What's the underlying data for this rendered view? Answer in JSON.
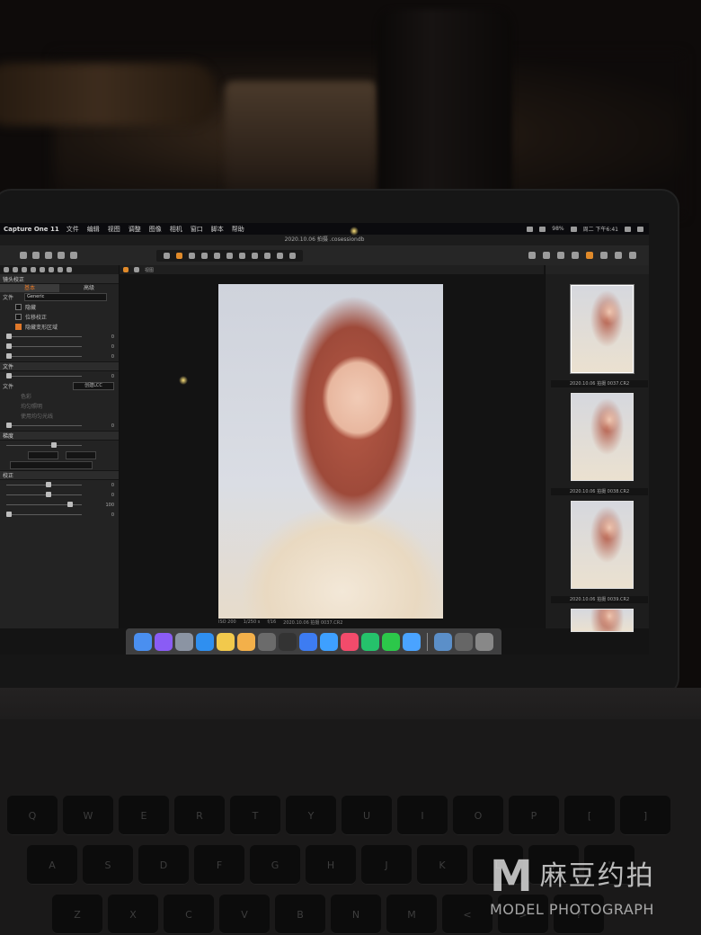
{
  "menubar": {
    "app_name": "Capture One 11",
    "items": [
      "文件",
      "编辑",
      "视图",
      "调整",
      "图像",
      "相机",
      "窗口",
      "脚本",
      "帮助"
    ],
    "battery": "98%",
    "datetime": "周二 下午6:41"
  },
  "titlebar": {
    "title": "2020.10.06 拍摄 .cosessiondb"
  },
  "left_panel": {
    "header": "镜头校正",
    "subtabs": [
      "基本",
      "高级"
    ],
    "profile_select": "Generic",
    "checks": [
      {
        "label": "隐藏",
        "checked": false
      },
      {
        "label": "位移校正",
        "checked": false
      },
      {
        "label": "隐藏变形区域",
        "checked": true
      }
    ],
    "lcc_section": "文件",
    "lcc_button": "创建LCC",
    "lcc_options": [
      "色彩",
      "均匀照明",
      "使用均匀光线"
    ],
    "section2": "梯度",
    "section3": "校正",
    "value_100": "100",
    "value_0": "0"
  },
  "viewer": {
    "bar_labels": [
      "视图"
    ],
    "caption": [
      "ISO 200",
      "1/250 s",
      "f/16",
      "2020.10.06 拍摄 0037.CR2"
    ]
  },
  "filmstrip": {
    "thumbs": [
      {
        "label": "2020.10.06 拍摄 0037.CR2",
        "selected": true
      },
      {
        "label": "2020.10.06 拍摄 0038.CR2",
        "selected": false
      },
      {
        "label": "2020.10.06 拍摄 0039.CR2",
        "selected": false
      }
    ]
  },
  "dock": {
    "icons": [
      "finder-icon",
      "siri-icon",
      "launchpad-icon",
      "safari-icon",
      "chrome-icon",
      "photos-icon",
      "capture-one-icon",
      "app-icon",
      "baidu-netdisk-icon",
      "wps-icon",
      "photo-app-icon",
      "media-player-icon",
      "wechat-icon",
      "info-icon",
      "preview-icon",
      "downloads-icon",
      "trash-icon"
    ],
    "colors": [
      "#4a8ff0",
      "#8a5cf5",
      "#8b94a3",
      "#2f8ff0",
      "#f2c94c",
      "#f3b04a",
      "#6b6b6b",
      "#333333",
      "#3d7cf2",
      "#3ea0ff",
      "#f24b6b",
      "#25c26b",
      "#2cc84a",
      "#4aa3ff",
      "#5b8fc9",
      "#666666",
      "#888888"
    ]
  },
  "watermark": {
    "logo": "M",
    "cn": "麻豆约拍",
    "en": "MODEL PHOTOGRAPH"
  },
  "keyboard": {
    "rows": [
      [
        "Q",
        "W",
        "E",
        "R",
        "T",
        "Y",
        "U",
        "I",
        "O",
        "P",
        "[",
        "]"
      ],
      [
        "A",
        "S",
        "D",
        "F",
        "G",
        "H",
        "J",
        "K",
        "L",
        ";",
        "'"
      ],
      [
        "Z",
        "X",
        "C",
        "V",
        "B",
        "N",
        "M",
        "<",
        ">",
        "?"
      ]
    ]
  }
}
